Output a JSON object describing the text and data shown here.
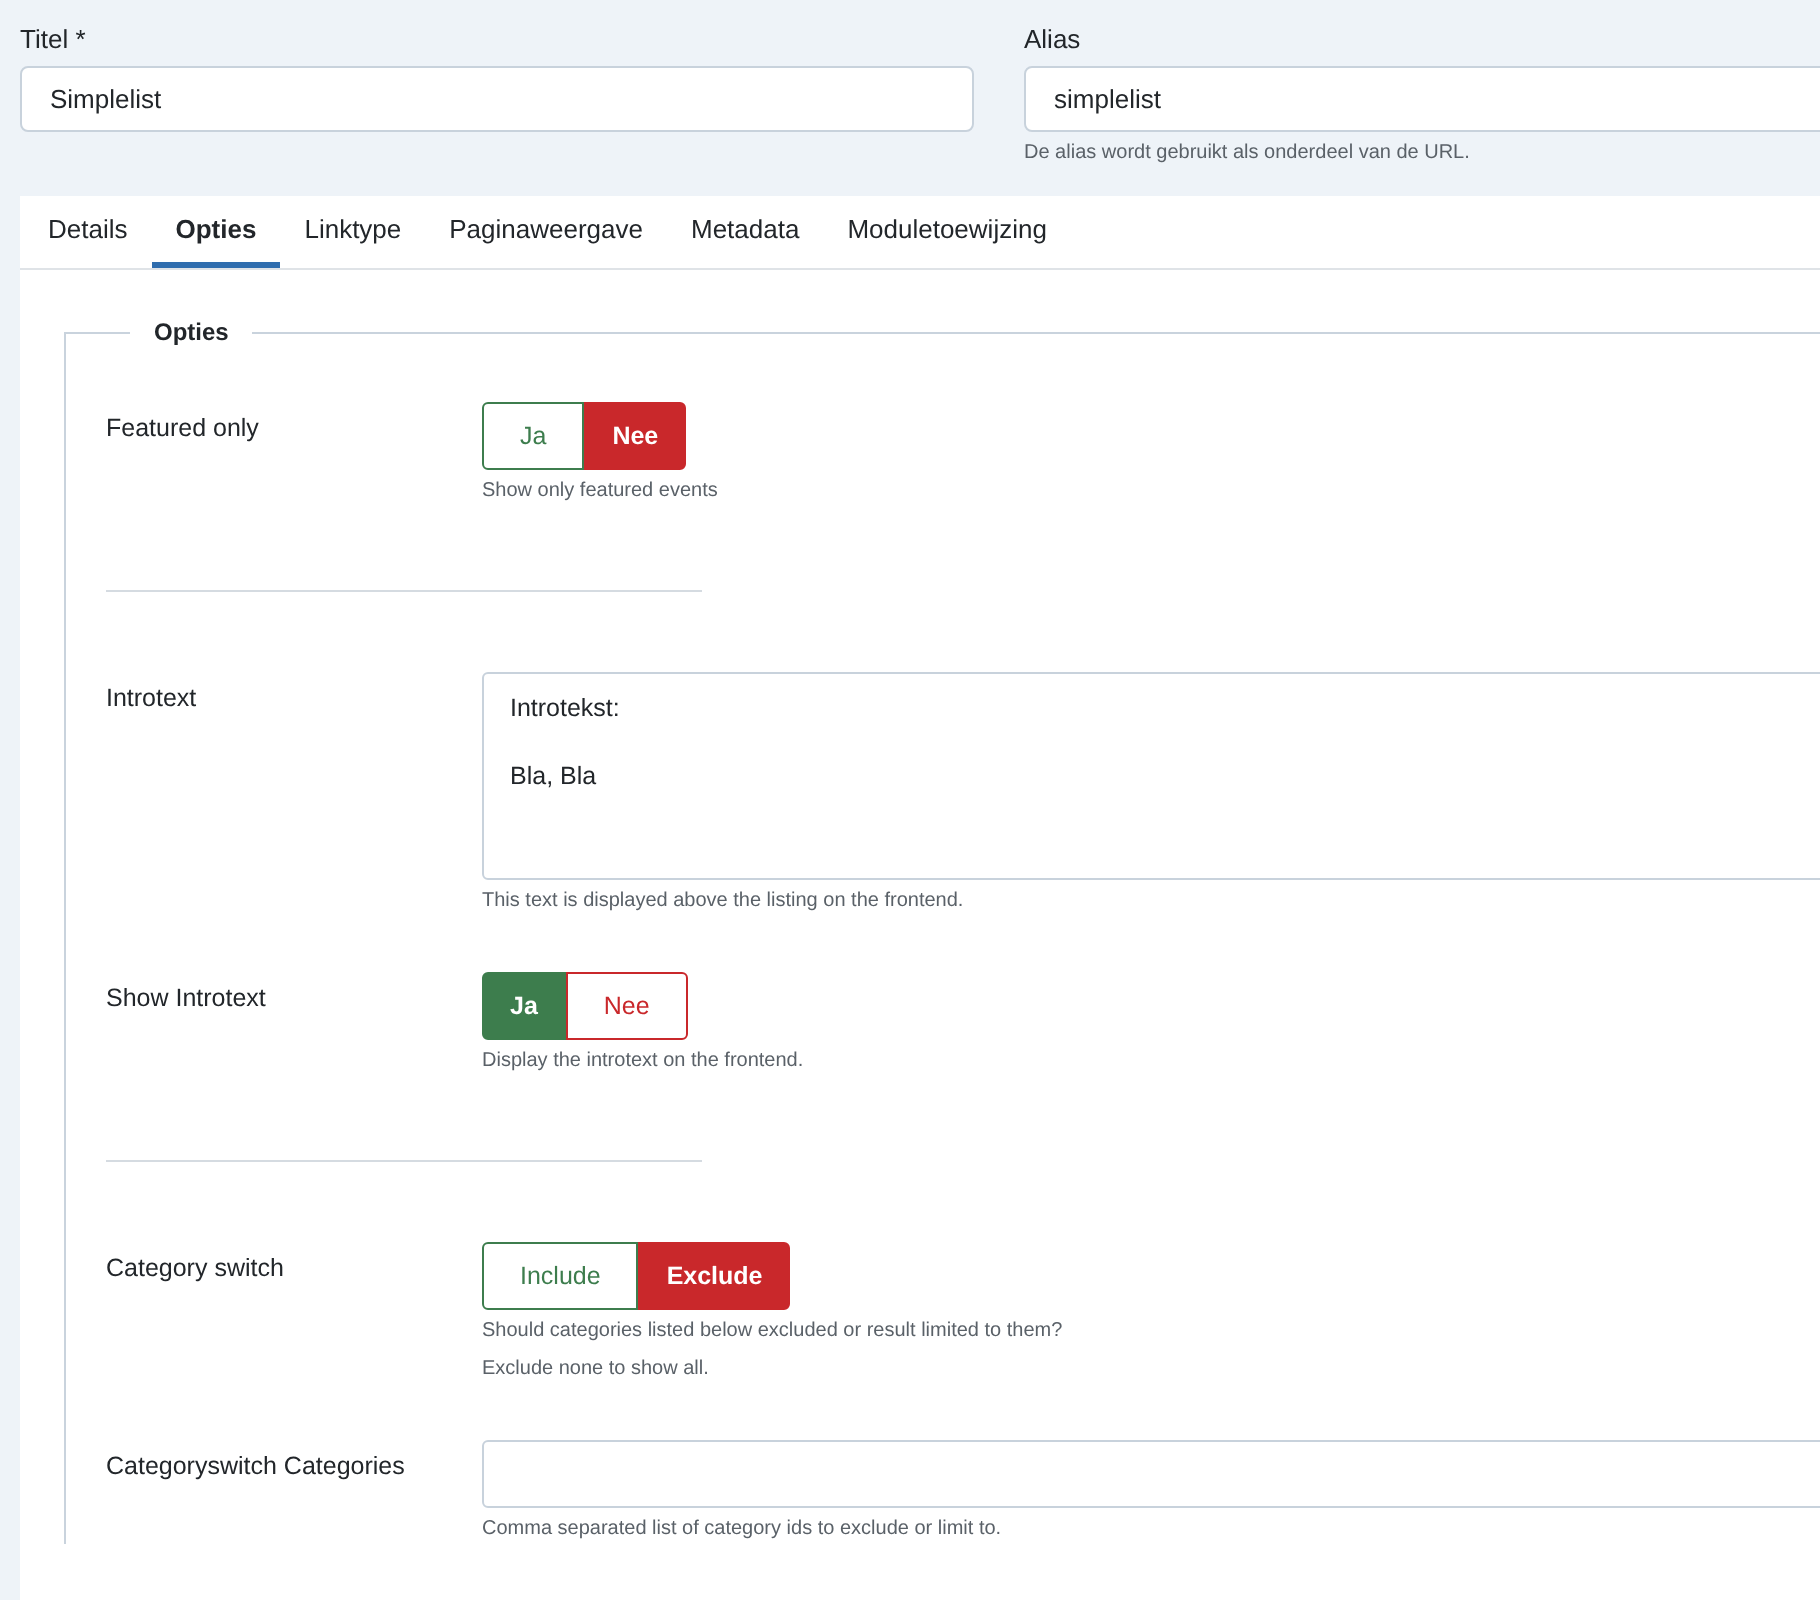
{
  "header_fields": [
    {
      "label": "Titel *",
      "value": "Simplelist"
    },
    {
      "label": "Alias",
      "value": "simplelist",
      "hint": "De alias wordt gebruikt als onderdeel van de URL."
    }
  ],
  "tabs": [
    {
      "label": "Details",
      "selected": false
    },
    {
      "label": "Opties",
      "selected": true
    },
    {
      "label": "Linktype",
      "selected": false
    },
    {
      "label": "Paginaweergave",
      "selected": false
    },
    {
      "label": "Metadata",
      "selected": false
    },
    {
      "label": "Moduletoewijzing",
      "selected": false
    }
  ],
  "fieldset": {
    "legend": "Opties",
    "fields": [
      {
        "kind": "toggle",
        "label": "Featured only",
        "options": [
          {
            "label": "Ja",
            "selected": false,
            "color": "#3d7d4d"
          },
          {
            "label": "Nee",
            "selected": true,
            "color": "#c9282b"
          }
        ],
        "hints": [
          "Show only featured events"
        ],
        "divider_after": true
      },
      {
        "kind": "textarea",
        "label": "Introtext",
        "lines": [
          "Introtekst:",
          "Bla, Bla"
        ],
        "hints": [
          "This text is displayed above the listing on the frontend."
        ],
        "divider_after": false
      },
      {
        "kind": "toggle",
        "label": "Show Introtext",
        "options": [
          {
            "label": "Ja",
            "selected": true,
            "color": "#3d7d4d"
          },
          {
            "label": "Nee",
            "selected": false,
            "color": "#c9282b"
          }
        ],
        "hints": [
          "Display the introtext on the frontend."
        ],
        "divider_after": true
      },
      {
        "kind": "toggle",
        "label": "Category switch",
        "options": [
          {
            "label": "Include",
            "selected": false,
            "color": "#3d7d4d"
          },
          {
            "label": "Exclude",
            "selected": true,
            "color": "#c9282b"
          }
        ],
        "hints": [
          "Should categories listed below excluded or result limited to them?",
          "Exclude none to show all."
        ],
        "divider_after": false
      },
      {
        "kind": "text",
        "label": "Categoryswitch Categories",
        "hints": [
          "Comma separated list of category ids to exclude or limit to."
        ],
        "divider_after": false
      }
    ]
  }
}
